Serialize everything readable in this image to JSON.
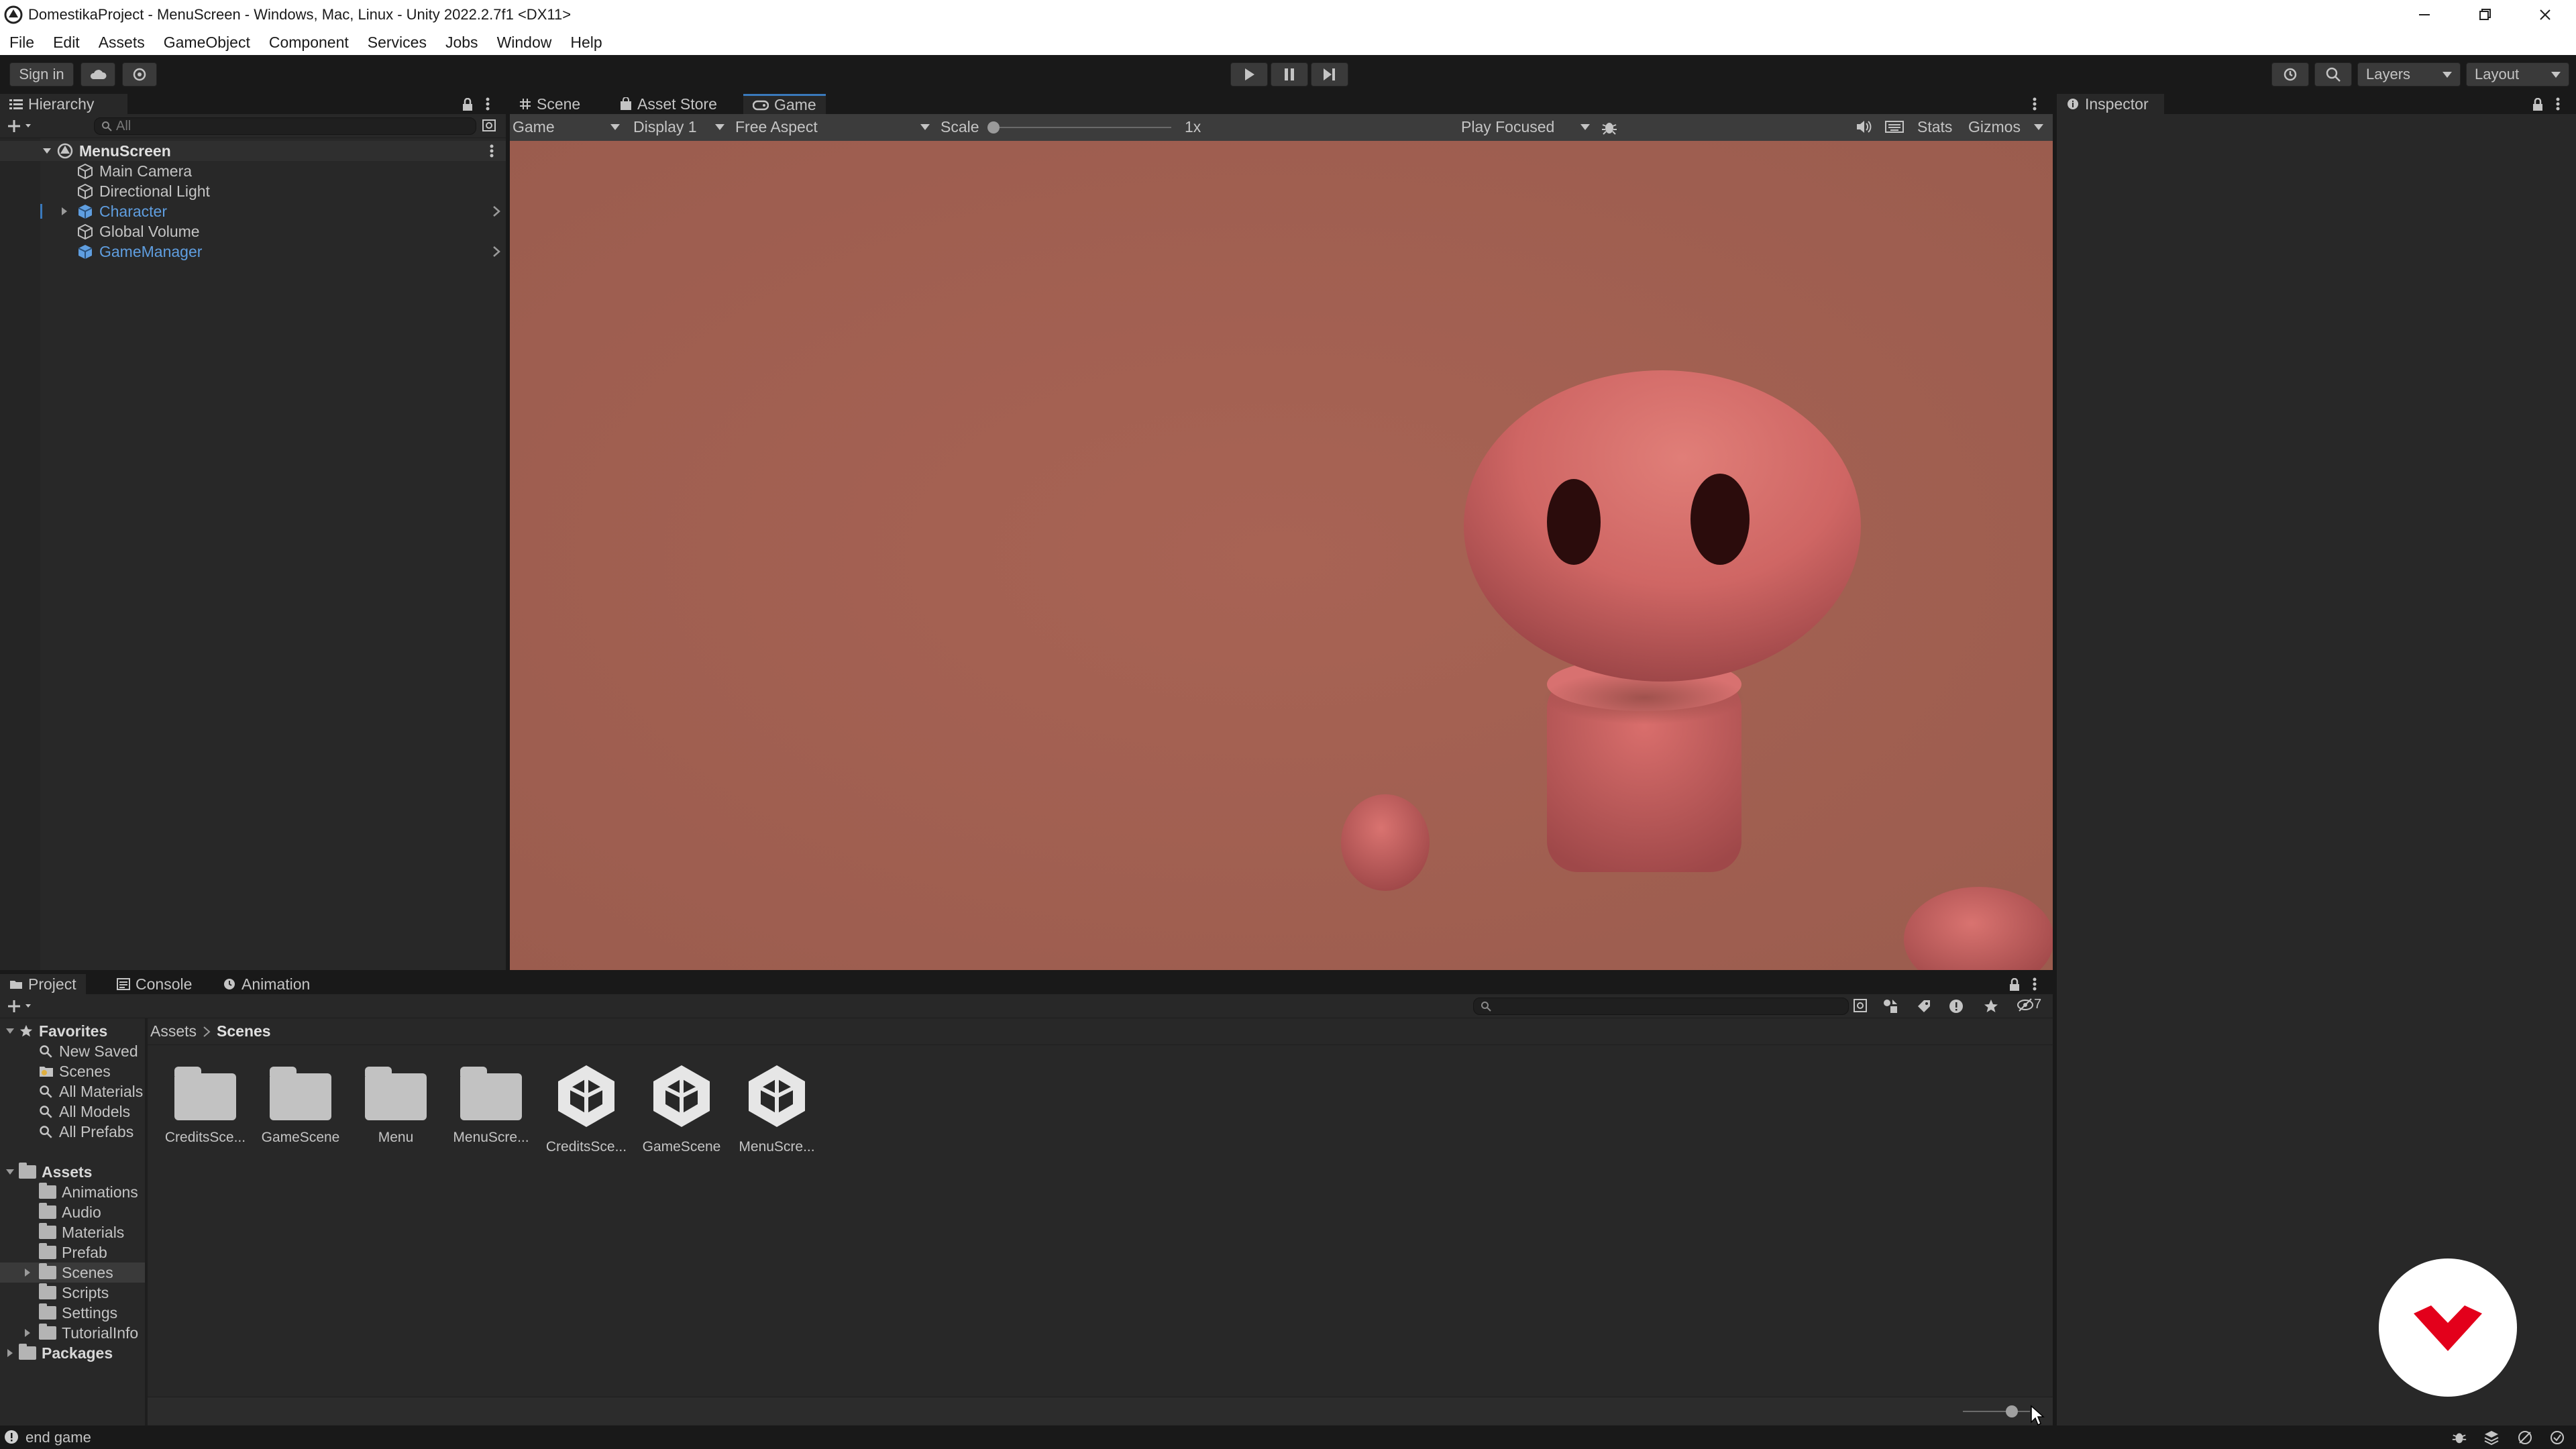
{
  "titlebar": {
    "title": "DomestikaProject - MenuScreen - Windows, Mac, Linux - Unity 2022.2.7f1 <DX11>"
  },
  "menubar": {
    "items": [
      "File",
      "Edit",
      "Assets",
      "GameObject",
      "Component",
      "Services",
      "Jobs",
      "Window",
      "Help"
    ]
  },
  "toolbar": {
    "sign_in": "Sign in",
    "layers": "Layers",
    "layout": "Layout"
  },
  "hierarchy": {
    "tab_label": "Hierarchy",
    "search_placeholder": "All",
    "scene_name": "MenuScreen",
    "items": [
      {
        "label": "Main Camera",
        "prefab": false,
        "expandable": false
      },
      {
        "label": "Directional Light",
        "prefab": false,
        "expandable": false
      },
      {
        "label": "Character",
        "prefab": true,
        "expandable": true
      },
      {
        "label": "Global Volume",
        "prefab": false,
        "expandable": false
      },
      {
        "label": "GameManager",
        "prefab": true,
        "expandable": false
      }
    ]
  },
  "gameview": {
    "tabs": [
      "Scene",
      "Asset Store",
      "Game"
    ],
    "active_tab": "Game",
    "mode": "Game",
    "display": "Display 1",
    "aspect": "Free Aspect",
    "scale_label": "Scale",
    "scale_value": "1x",
    "play_focus": "Play Focused",
    "stats": "Stats",
    "gizmos": "Gizmos",
    "background_color": "#a06050"
  },
  "inspector": {
    "tab_label": "Inspector"
  },
  "project": {
    "tabs": [
      "Project",
      "Console",
      "Animation"
    ],
    "active_tab": "Project",
    "visible_count": "7",
    "favorites": {
      "label": "Favorites",
      "items": [
        "New Saved",
        "Scenes",
        "All Materials",
        "All Models",
        "All Prefabs"
      ]
    },
    "assets": {
      "label": "Assets",
      "items": [
        "Animations",
        "Audio",
        "Materials",
        "Prefab",
        "Scenes",
        "Scripts",
        "Settings",
        "TutorialInfo"
      ],
      "selected": "Scenes"
    },
    "packages_label": "Packages",
    "breadcrumb": [
      "Assets",
      "Scenes"
    ],
    "grid": [
      {
        "label": "CreditsSce...",
        "kind": "folder"
      },
      {
        "label": "GameScene",
        "kind": "folder"
      },
      {
        "label": "Menu",
        "kind": "folder"
      },
      {
        "label": "MenuScre...",
        "kind": "folder"
      },
      {
        "label": "CreditsSce...",
        "kind": "scene"
      },
      {
        "label": "GameScene",
        "kind": "scene"
      },
      {
        "label": "MenuScre...",
        "kind": "scene"
      }
    ]
  },
  "statusbar": {
    "message": "end game"
  },
  "overlay": {
    "logo_color": "#e3001b"
  }
}
